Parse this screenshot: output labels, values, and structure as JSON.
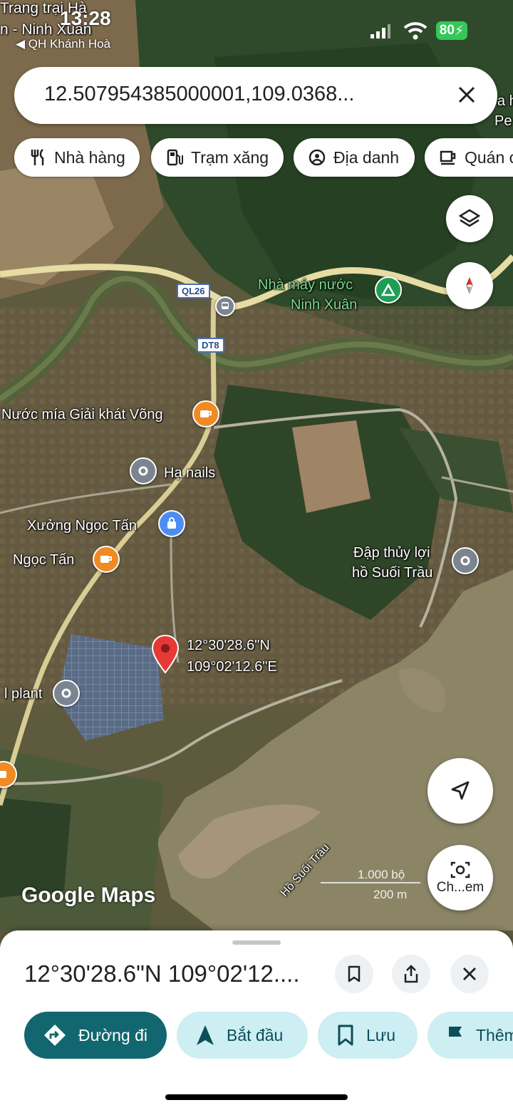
{
  "status_bar": {
    "time": "13:28",
    "back_app": "◀ QH Khánh Hoà",
    "battery": "80"
  },
  "search": {
    "query": "12.507954385000001,109.0368..."
  },
  "chips": [
    "Nhà hàng",
    "Trạm xăng",
    "Địa danh",
    "Quán c"
  ],
  "map": {
    "top_labels": [
      "Trang trại Hà",
      "n - Ninh Xuân"
    ],
    "top_right_labels": [
      "a h",
      "Pe"
    ],
    "roads": [
      "QL26",
      "DT8"
    ],
    "places": [
      {
        "name": "Nhà máy nước\nNinh Xuân",
        "line1": "Nhà máy nước",
        "line2": "Ninh Xuân"
      },
      {
        "name": "Nước mía Giải khát Võng"
      },
      {
        "name": "Hạ nails"
      },
      {
        "name": "Xưởng Ngọc Tấn"
      },
      {
        "name": "Ngọc Tấn"
      },
      {
        "name": "Đập thủy lợi hồ Suối Trầu",
        "line1": "Đập thủy lợi",
        "line2": "hồ Suối Trầu"
      },
      {
        "name": "l plant"
      }
    ],
    "pin": {
      "line1": "12°30'28.6\"N",
      "line2": "109°02'12.6\"E"
    },
    "lake_label": "Hồ Suối Trầu",
    "logo": "Google Maps",
    "scale": {
      "imperial": "1.000 bộ",
      "metric": "200 m"
    },
    "camera_label": "Ch...em",
    "colors": {
      "water": "#8b8566",
      "forest": "#2f4a2a",
      "road": "#e7dca4",
      "pin": "#e53935"
    }
  },
  "sheet": {
    "coords": "12°30'28.6\"N 109°02'12....",
    "actions": [
      {
        "label": "Đường đi"
      },
      {
        "label": "Bắt đầu"
      },
      {
        "label": "Lưu"
      },
      {
        "label": "Thêm"
      }
    ]
  }
}
